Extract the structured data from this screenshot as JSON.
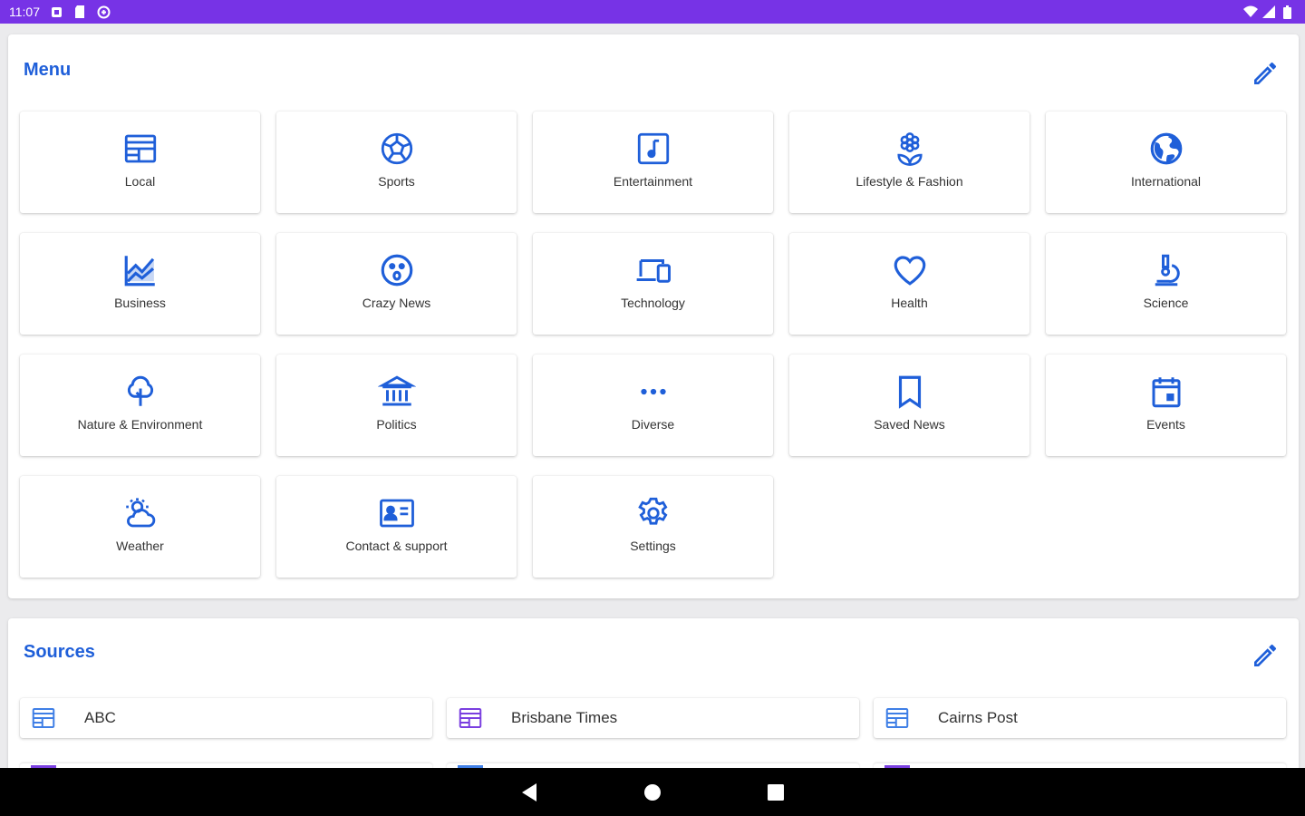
{
  "status_bar": {
    "time": "11:07",
    "left_icons": [
      "notification-icon",
      "sd-card-icon",
      "data-saver-icon"
    ],
    "right_icons": [
      "wifi-icon",
      "signal-icon",
      "battery-icon"
    ],
    "color": "#7733e6"
  },
  "menu": {
    "title": "Menu",
    "edit_icon": "pencil-icon",
    "items": [
      {
        "label": "Local",
        "icon": "newspaper-icon"
      },
      {
        "label": "Sports",
        "icon": "soccer-ball-icon"
      },
      {
        "label": "Entertainment",
        "icon": "music-note-icon"
      },
      {
        "label": "Lifestyle & Fashion",
        "icon": "flower-icon"
      },
      {
        "label": "International",
        "icon": "globe-icon"
      },
      {
        "label": "Business",
        "icon": "chart-icon"
      },
      {
        "label": "Crazy News",
        "icon": "surprised-face-icon"
      },
      {
        "label": "Technology",
        "icon": "devices-icon"
      },
      {
        "label": "Health",
        "icon": "heart-icon"
      },
      {
        "label": "Science",
        "icon": "microscope-icon"
      },
      {
        "label": "Nature & Environment",
        "icon": "tree-icon"
      },
      {
        "label": "Politics",
        "icon": "bank-icon"
      },
      {
        "label": "Diverse",
        "icon": "more-horizontal-icon"
      },
      {
        "label": "Saved News",
        "icon": "bookmark-icon"
      },
      {
        "label": "Events",
        "icon": "calendar-icon"
      },
      {
        "label": "Weather",
        "icon": "weather-icon"
      },
      {
        "label": "Contact & support",
        "icon": "contact-card-icon"
      },
      {
        "label": "Settings",
        "icon": "gear-icon"
      }
    ]
  },
  "sources": {
    "title": "Sources",
    "edit_icon": "pencil-icon",
    "items": [
      {
        "label": "ABC",
        "icon": "newspaper-icon",
        "color": "#3f7fe6"
      },
      {
        "label": "Brisbane Times",
        "icon": "newspaper-icon",
        "color": "#7a3fe0"
      },
      {
        "label": "Cairns Post",
        "icon": "newspaper-icon",
        "color": "#3f7fe6"
      }
    ]
  },
  "nav_bar": {
    "buttons": [
      "back-icon",
      "home-icon",
      "recents-icon"
    ]
  },
  "colors": {
    "accent": "#1f5fd9",
    "status_bar": "#7733e6",
    "background": "#ebebed",
    "nav_bar": "#000000"
  }
}
